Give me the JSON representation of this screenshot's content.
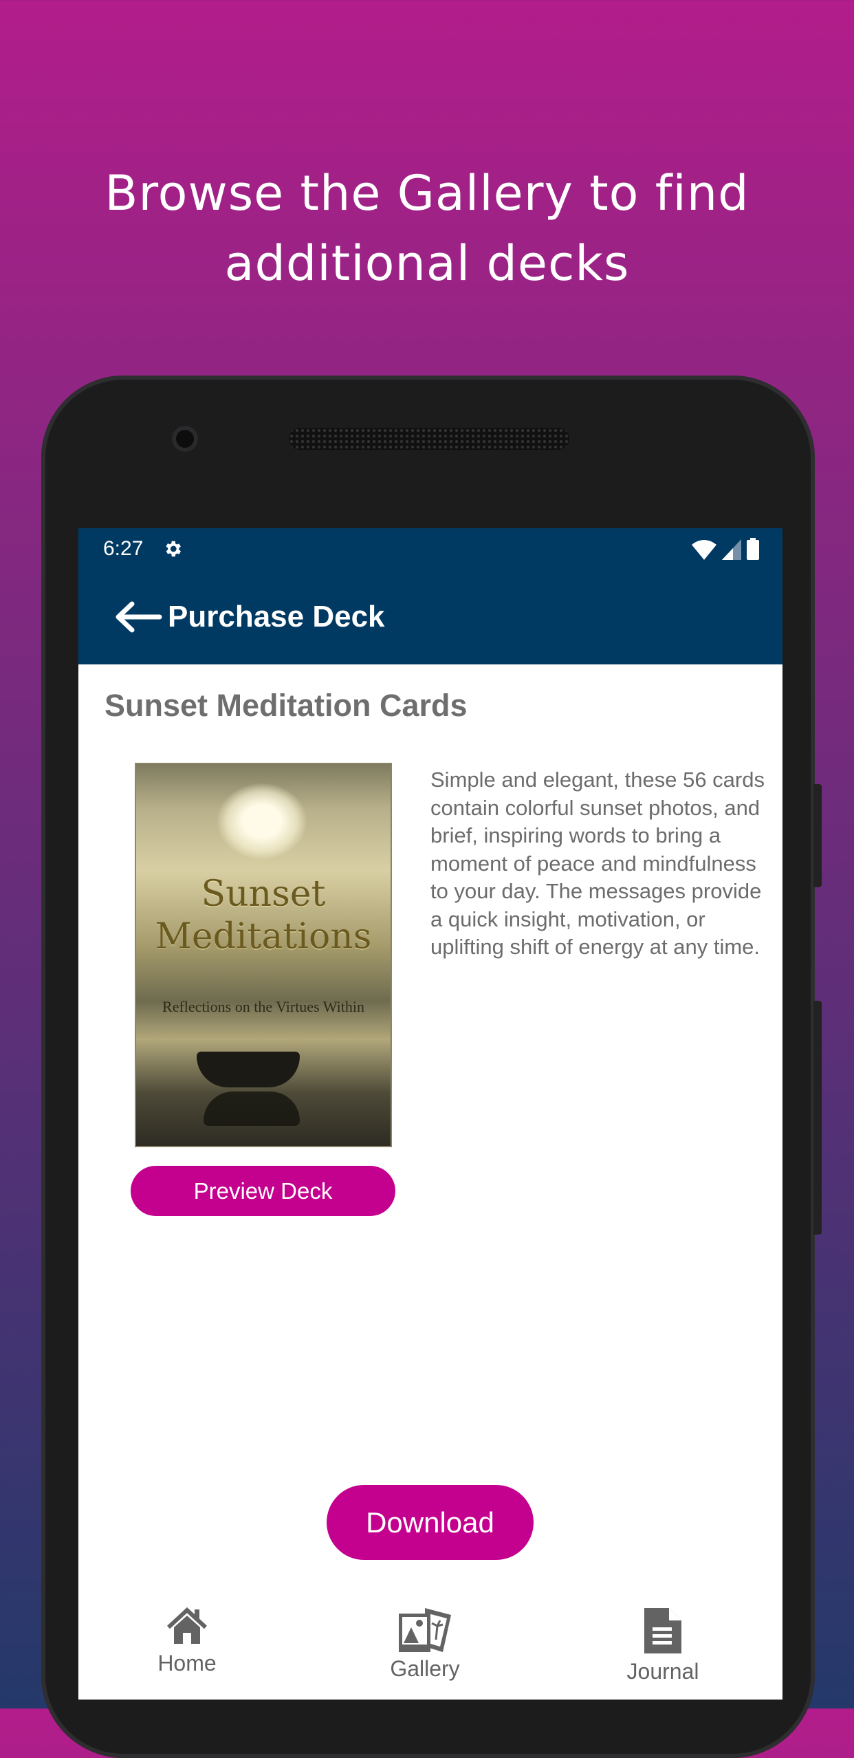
{
  "promo": {
    "line1": "Browse the Gallery to find",
    "line2": "additional decks"
  },
  "status_bar": {
    "time": "6:27",
    "icons": [
      "gear-icon",
      "wifi-icon",
      "signal-icon",
      "battery-icon"
    ]
  },
  "app_bar": {
    "title": "Purchase Deck",
    "back_icon": "arrow-left-icon"
  },
  "deck": {
    "title": "Sunset Meditation Cards",
    "cover": {
      "title_line1": "Sunset",
      "title_line2": "Meditations",
      "subtitle": "Reflections on the Virtues Within"
    },
    "preview_label": "Preview Deck",
    "description": "Simple and elegant, these 56 cards contain colorful sunset photos, and brief, inspiring words to bring a moment of peace and mindfulness to your day. The messages provide a quick insight, motivation, or uplifting shift of energy at any time."
  },
  "download_label": "Download",
  "bottom_nav": [
    {
      "label": "Home",
      "icon": "home-icon"
    },
    {
      "label": "Gallery",
      "icon": "gallery-icon"
    },
    {
      "label": "Journal",
      "icon": "document-icon"
    }
  ],
  "colors": {
    "app_bar": "#003a63",
    "accent": "#c4008e",
    "bg_top": "#b21d8b",
    "bg_bottom": "#24396a"
  }
}
